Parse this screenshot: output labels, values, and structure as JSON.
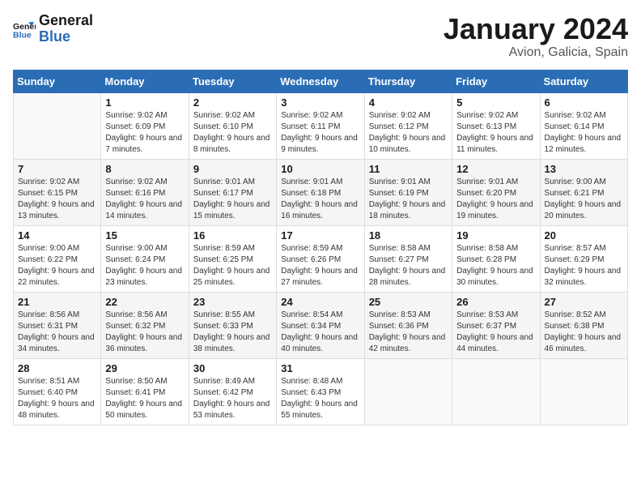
{
  "header": {
    "logo_line1": "General",
    "logo_line2": "Blue",
    "month_year": "January 2024",
    "location": "Avion, Galicia, Spain"
  },
  "days_of_week": [
    "Sunday",
    "Monday",
    "Tuesday",
    "Wednesday",
    "Thursday",
    "Friday",
    "Saturday"
  ],
  "weeks": [
    [
      {
        "num": "",
        "sunrise": "",
        "sunset": "",
        "daylight": ""
      },
      {
        "num": "1",
        "sunrise": "Sunrise: 9:02 AM",
        "sunset": "Sunset: 6:09 PM",
        "daylight": "Daylight: 9 hours and 7 minutes."
      },
      {
        "num": "2",
        "sunrise": "Sunrise: 9:02 AM",
        "sunset": "Sunset: 6:10 PM",
        "daylight": "Daylight: 9 hours and 8 minutes."
      },
      {
        "num": "3",
        "sunrise": "Sunrise: 9:02 AM",
        "sunset": "Sunset: 6:11 PM",
        "daylight": "Daylight: 9 hours and 9 minutes."
      },
      {
        "num": "4",
        "sunrise": "Sunrise: 9:02 AM",
        "sunset": "Sunset: 6:12 PM",
        "daylight": "Daylight: 9 hours and 10 minutes."
      },
      {
        "num": "5",
        "sunrise": "Sunrise: 9:02 AM",
        "sunset": "Sunset: 6:13 PM",
        "daylight": "Daylight: 9 hours and 11 minutes."
      },
      {
        "num": "6",
        "sunrise": "Sunrise: 9:02 AM",
        "sunset": "Sunset: 6:14 PM",
        "daylight": "Daylight: 9 hours and 12 minutes."
      }
    ],
    [
      {
        "num": "7",
        "sunrise": "Sunrise: 9:02 AM",
        "sunset": "Sunset: 6:15 PM",
        "daylight": "Daylight: 9 hours and 13 minutes."
      },
      {
        "num": "8",
        "sunrise": "Sunrise: 9:02 AM",
        "sunset": "Sunset: 6:16 PM",
        "daylight": "Daylight: 9 hours and 14 minutes."
      },
      {
        "num": "9",
        "sunrise": "Sunrise: 9:01 AM",
        "sunset": "Sunset: 6:17 PM",
        "daylight": "Daylight: 9 hours and 15 minutes."
      },
      {
        "num": "10",
        "sunrise": "Sunrise: 9:01 AM",
        "sunset": "Sunset: 6:18 PM",
        "daylight": "Daylight: 9 hours and 16 minutes."
      },
      {
        "num": "11",
        "sunrise": "Sunrise: 9:01 AM",
        "sunset": "Sunset: 6:19 PM",
        "daylight": "Daylight: 9 hours and 18 minutes."
      },
      {
        "num": "12",
        "sunrise": "Sunrise: 9:01 AM",
        "sunset": "Sunset: 6:20 PM",
        "daylight": "Daylight: 9 hours and 19 minutes."
      },
      {
        "num": "13",
        "sunrise": "Sunrise: 9:00 AM",
        "sunset": "Sunset: 6:21 PM",
        "daylight": "Daylight: 9 hours and 20 minutes."
      }
    ],
    [
      {
        "num": "14",
        "sunrise": "Sunrise: 9:00 AM",
        "sunset": "Sunset: 6:22 PM",
        "daylight": "Daylight: 9 hours and 22 minutes."
      },
      {
        "num": "15",
        "sunrise": "Sunrise: 9:00 AM",
        "sunset": "Sunset: 6:24 PM",
        "daylight": "Daylight: 9 hours and 23 minutes."
      },
      {
        "num": "16",
        "sunrise": "Sunrise: 8:59 AM",
        "sunset": "Sunset: 6:25 PM",
        "daylight": "Daylight: 9 hours and 25 minutes."
      },
      {
        "num": "17",
        "sunrise": "Sunrise: 8:59 AM",
        "sunset": "Sunset: 6:26 PM",
        "daylight": "Daylight: 9 hours and 27 minutes."
      },
      {
        "num": "18",
        "sunrise": "Sunrise: 8:58 AM",
        "sunset": "Sunset: 6:27 PM",
        "daylight": "Daylight: 9 hours and 28 minutes."
      },
      {
        "num": "19",
        "sunrise": "Sunrise: 8:58 AM",
        "sunset": "Sunset: 6:28 PM",
        "daylight": "Daylight: 9 hours and 30 minutes."
      },
      {
        "num": "20",
        "sunrise": "Sunrise: 8:57 AM",
        "sunset": "Sunset: 6:29 PM",
        "daylight": "Daylight: 9 hours and 32 minutes."
      }
    ],
    [
      {
        "num": "21",
        "sunrise": "Sunrise: 8:56 AM",
        "sunset": "Sunset: 6:31 PM",
        "daylight": "Daylight: 9 hours and 34 minutes."
      },
      {
        "num": "22",
        "sunrise": "Sunrise: 8:56 AM",
        "sunset": "Sunset: 6:32 PM",
        "daylight": "Daylight: 9 hours and 36 minutes."
      },
      {
        "num": "23",
        "sunrise": "Sunrise: 8:55 AM",
        "sunset": "Sunset: 6:33 PM",
        "daylight": "Daylight: 9 hours and 38 minutes."
      },
      {
        "num": "24",
        "sunrise": "Sunrise: 8:54 AM",
        "sunset": "Sunset: 6:34 PM",
        "daylight": "Daylight: 9 hours and 40 minutes."
      },
      {
        "num": "25",
        "sunrise": "Sunrise: 8:53 AM",
        "sunset": "Sunset: 6:36 PM",
        "daylight": "Daylight: 9 hours and 42 minutes."
      },
      {
        "num": "26",
        "sunrise": "Sunrise: 8:53 AM",
        "sunset": "Sunset: 6:37 PM",
        "daylight": "Daylight: 9 hours and 44 minutes."
      },
      {
        "num": "27",
        "sunrise": "Sunrise: 8:52 AM",
        "sunset": "Sunset: 6:38 PM",
        "daylight": "Daylight: 9 hours and 46 minutes."
      }
    ],
    [
      {
        "num": "28",
        "sunrise": "Sunrise: 8:51 AM",
        "sunset": "Sunset: 6:40 PM",
        "daylight": "Daylight: 9 hours and 48 minutes."
      },
      {
        "num": "29",
        "sunrise": "Sunrise: 8:50 AM",
        "sunset": "Sunset: 6:41 PM",
        "daylight": "Daylight: 9 hours and 50 minutes."
      },
      {
        "num": "30",
        "sunrise": "Sunrise: 8:49 AM",
        "sunset": "Sunset: 6:42 PM",
        "daylight": "Daylight: 9 hours and 53 minutes."
      },
      {
        "num": "31",
        "sunrise": "Sunrise: 8:48 AM",
        "sunset": "Sunset: 6:43 PM",
        "daylight": "Daylight: 9 hours and 55 minutes."
      },
      {
        "num": "",
        "sunrise": "",
        "sunset": "",
        "daylight": ""
      },
      {
        "num": "",
        "sunrise": "",
        "sunset": "",
        "daylight": ""
      },
      {
        "num": "",
        "sunrise": "",
        "sunset": "",
        "daylight": ""
      }
    ]
  ]
}
